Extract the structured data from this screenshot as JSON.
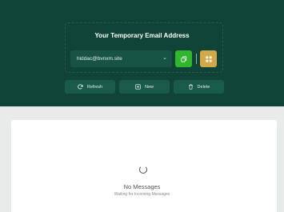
{
  "email": {
    "title": "Your Temporary Email Address",
    "address": "hiddac@bvnxm.site"
  },
  "actions": {
    "refresh": "Refresh",
    "new": "New",
    "delete": "Delete"
  },
  "inbox": {
    "empty_title": "No Messages",
    "empty_subtitle": "Waiting for Incoming Messages"
  },
  "colors": {
    "hero_bg": "#0f4436",
    "copy_button": "#33b52f",
    "qr_button": "#d2a84b"
  },
  "icons": {
    "copy": "copy-icon",
    "qr": "qr-code-icon",
    "refresh": "refresh-icon",
    "new": "plus-square-icon",
    "delete": "trash-icon",
    "loading": "spinner-icon"
  }
}
